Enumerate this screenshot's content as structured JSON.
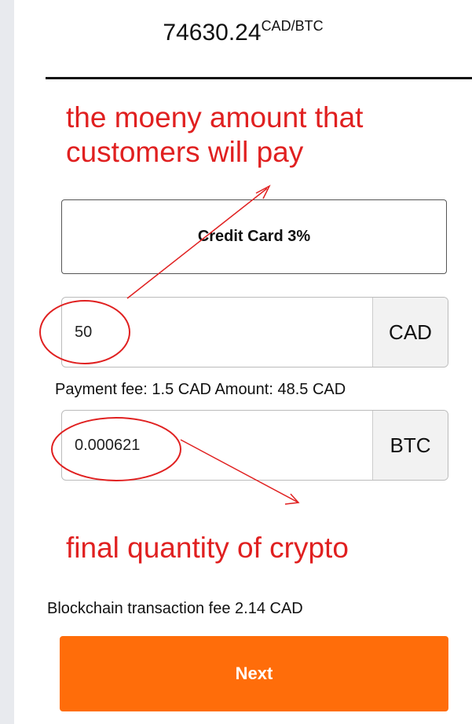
{
  "rate": {
    "value": "74630.24",
    "unit": "CAD/BTC"
  },
  "annotations": {
    "top_line1": "the moeny amount that",
    "top_line2": "customers will pay",
    "bottom": "final quantity of crypto",
    "color": "#e02020"
  },
  "payment_method": {
    "label": "Credit Card 3%"
  },
  "fiat_input": {
    "value": "50",
    "currency": "CAD"
  },
  "fee_summary": "Payment fee: 1.5 CAD Amount:  48.5 CAD",
  "crypto_input": {
    "value": "0.000621",
    "currency": "BTC"
  },
  "blockchain_fee": "Blockchain transaction fee  2.14 CAD",
  "next_button": {
    "label": "Next",
    "color": "#ff6d0a"
  }
}
